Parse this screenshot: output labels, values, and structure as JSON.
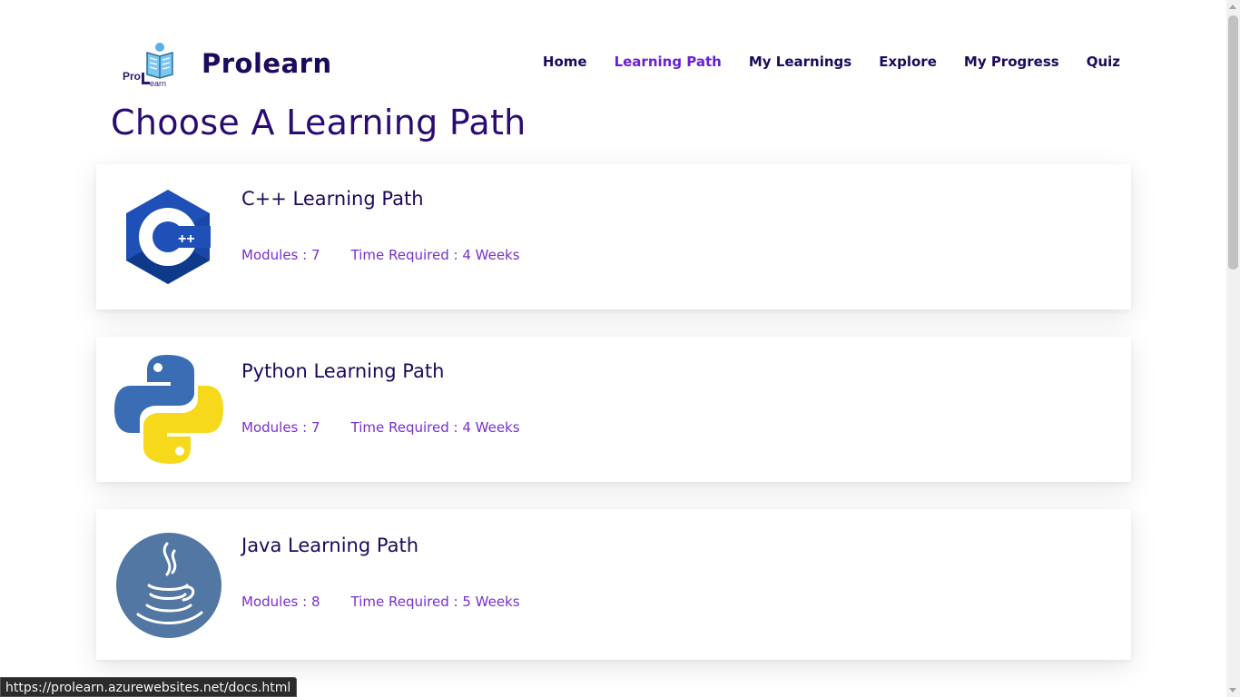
{
  "brand": {
    "name": "Prolearn",
    "logo_text_pro": "Pro",
    "logo_text_learn": "Learn"
  },
  "nav": {
    "items": [
      {
        "label": "Home",
        "active": false
      },
      {
        "label": "Learning Path",
        "active": true
      },
      {
        "label": "My Learnings",
        "active": false
      },
      {
        "label": "Explore",
        "active": false
      },
      {
        "label": "My Progress",
        "active": false
      },
      {
        "label": "Quiz",
        "active": false
      }
    ]
  },
  "page": {
    "title": "Choose A Learning Path"
  },
  "paths": [
    {
      "title": "C++ Learning Path",
      "modules": "Modules : 7",
      "time": "Time Required : 4 Weeks",
      "icon": "cpp-logo-icon"
    },
    {
      "title": "Python Learning Path",
      "modules": "Modules : 7",
      "time": "Time Required : 4 Weeks",
      "icon": "python-logo-icon"
    },
    {
      "title": "Java Learning Path",
      "modules": "Modules : 8",
      "time": "Time Required : 5 Weeks",
      "icon": "java-logo-icon"
    }
  ],
  "status_bar": {
    "url": "https://prolearn.azurewebsites.net/docs.html"
  },
  "colors": {
    "brand_dark": "#1c0a5c",
    "accent_purple": "#6a1fd6",
    "meta_purple": "#7a2fd0"
  }
}
